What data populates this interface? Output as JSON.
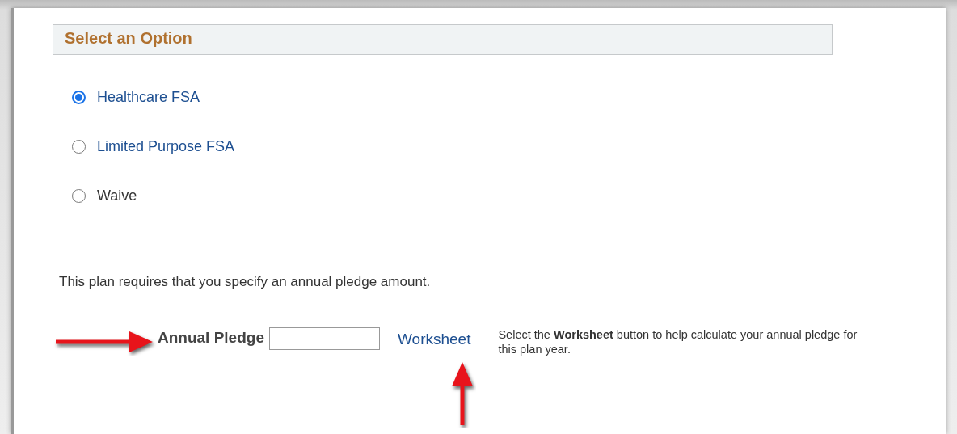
{
  "section": {
    "title": "Select an Option"
  },
  "options": [
    {
      "label": "Healthcare FSA",
      "selected": true,
      "kind": "link"
    },
    {
      "label": "Limited Purpose FSA",
      "selected": false,
      "kind": "link"
    },
    {
      "label": "Waive",
      "selected": false,
      "kind": "plain"
    }
  ],
  "note": "This plan requires that you specify an annual pledge amount.",
  "pledge": {
    "label": "Annual Pledge",
    "worksheet_link": "Worksheet",
    "help": "Select the **Worksheet** button to help calculate your annual pledge for this plan year."
  }
}
